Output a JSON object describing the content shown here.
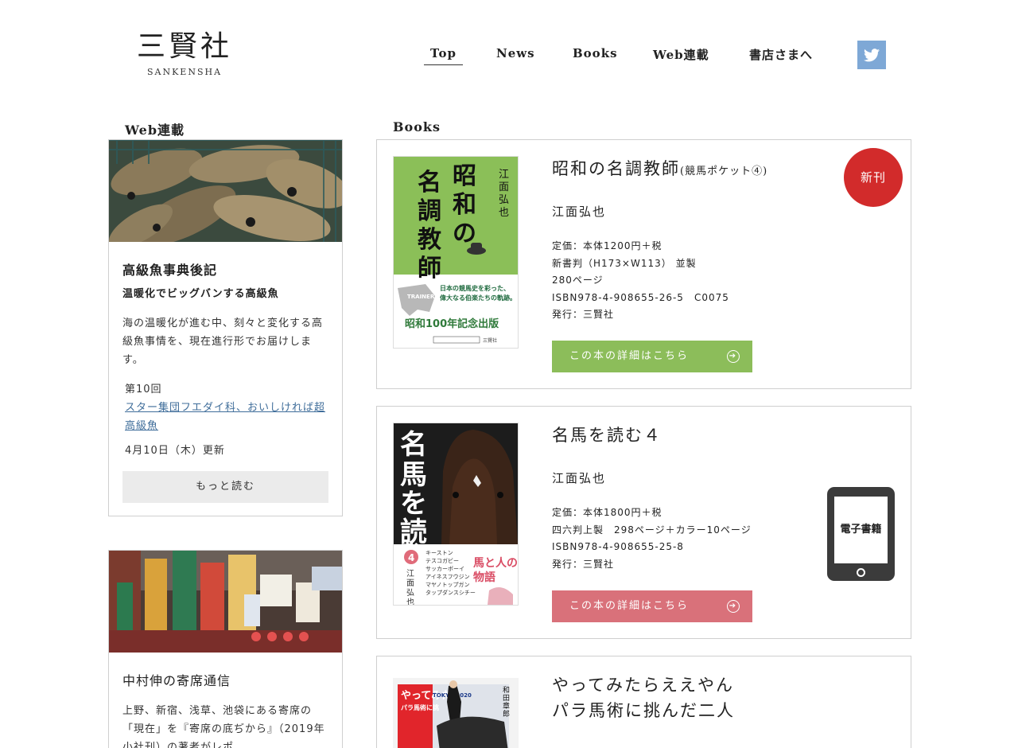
{
  "header": {
    "logo_main": "三賢社",
    "logo_sub": "SANKENSHA",
    "nav": [
      "Top",
      "News",
      "Books",
      "Web連載",
      "書店さまへ"
    ],
    "twitter_icon": "twitter-icon"
  },
  "sections": {
    "web_title": "Web連載",
    "books_title": "Books"
  },
  "web_cards": [
    {
      "title": "高級魚事典後記",
      "subtitle": "温暖化でビッグバンする高級魚",
      "desc": "海の温暖化が進む中、刻々と変化する高級魚事情を、現在進行形でお届けします。",
      "episode": "第10回",
      "link": "スター集団フエダイ科、おいしければ超高級魚",
      "date": "4月10日（木）更新",
      "more": "もっと読む"
    },
    {
      "title": "中村伸の寄席通信",
      "desc": "上野、新宿、浅草、池袋にある寄席の「現在」を『寄席の底ぢから』（2019年小社刊）の著者がレポ"
    }
  ],
  "books": [
    {
      "title": "昭和の名調教師",
      "title_small": "(競馬ポケット④)",
      "author": "江面弘也",
      "info": [
        "定価：本体1200円＋税",
        "新書判（H173×W113） 並製",
        "280ページ",
        "ISBN978-4-908655-26-5　C0075",
        "発行：三賢社"
      ],
      "button": "この本の詳細はこちら",
      "badge": "新刊",
      "cover": {
        "title": "昭和の名調教師",
        "author": "江面弘也",
        "tagline": "日本の競馬史を彩った、偉大なる伯楽たちの軌跡。",
        "banner": "昭和100年記念出版",
        "publisher": "三賢社",
        "horse_label": "TRAINER"
      }
    },
    {
      "title": "名馬を読む４",
      "author": "江面弘也",
      "info": [
        "定価：本体1800円＋税",
        "四六判上製　298ページ＋カラー10ページ",
        "ISBN978-4-908655-25-8",
        "発行：三賢社"
      ],
      "button": "この本の詳細はこちら",
      "ebook": "電子書籍",
      "cover": {
        "title": "名馬を読む",
        "number": "4",
        "author": "江面弘也",
        "subtitle": "馬と人の物語"
      }
    },
    {
      "title_line1": "やってみたらええやん",
      "title_line2": "パラ馬術に挑んだ二人",
      "cover": {
        "title": "やってみたら",
        "subtitle": "パラ馬術に挑",
        "author": "和田章郎",
        "event": "TOKYO 2020"
      }
    }
  ],
  "colors": {
    "green_button": "#8cbd5a",
    "pink_button": "#d9717a",
    "badge_red": "#d22b2b",
    "twitter_blue": "#7ea8d6",
    "link_blue": "#3f6d9a"
  }
}
